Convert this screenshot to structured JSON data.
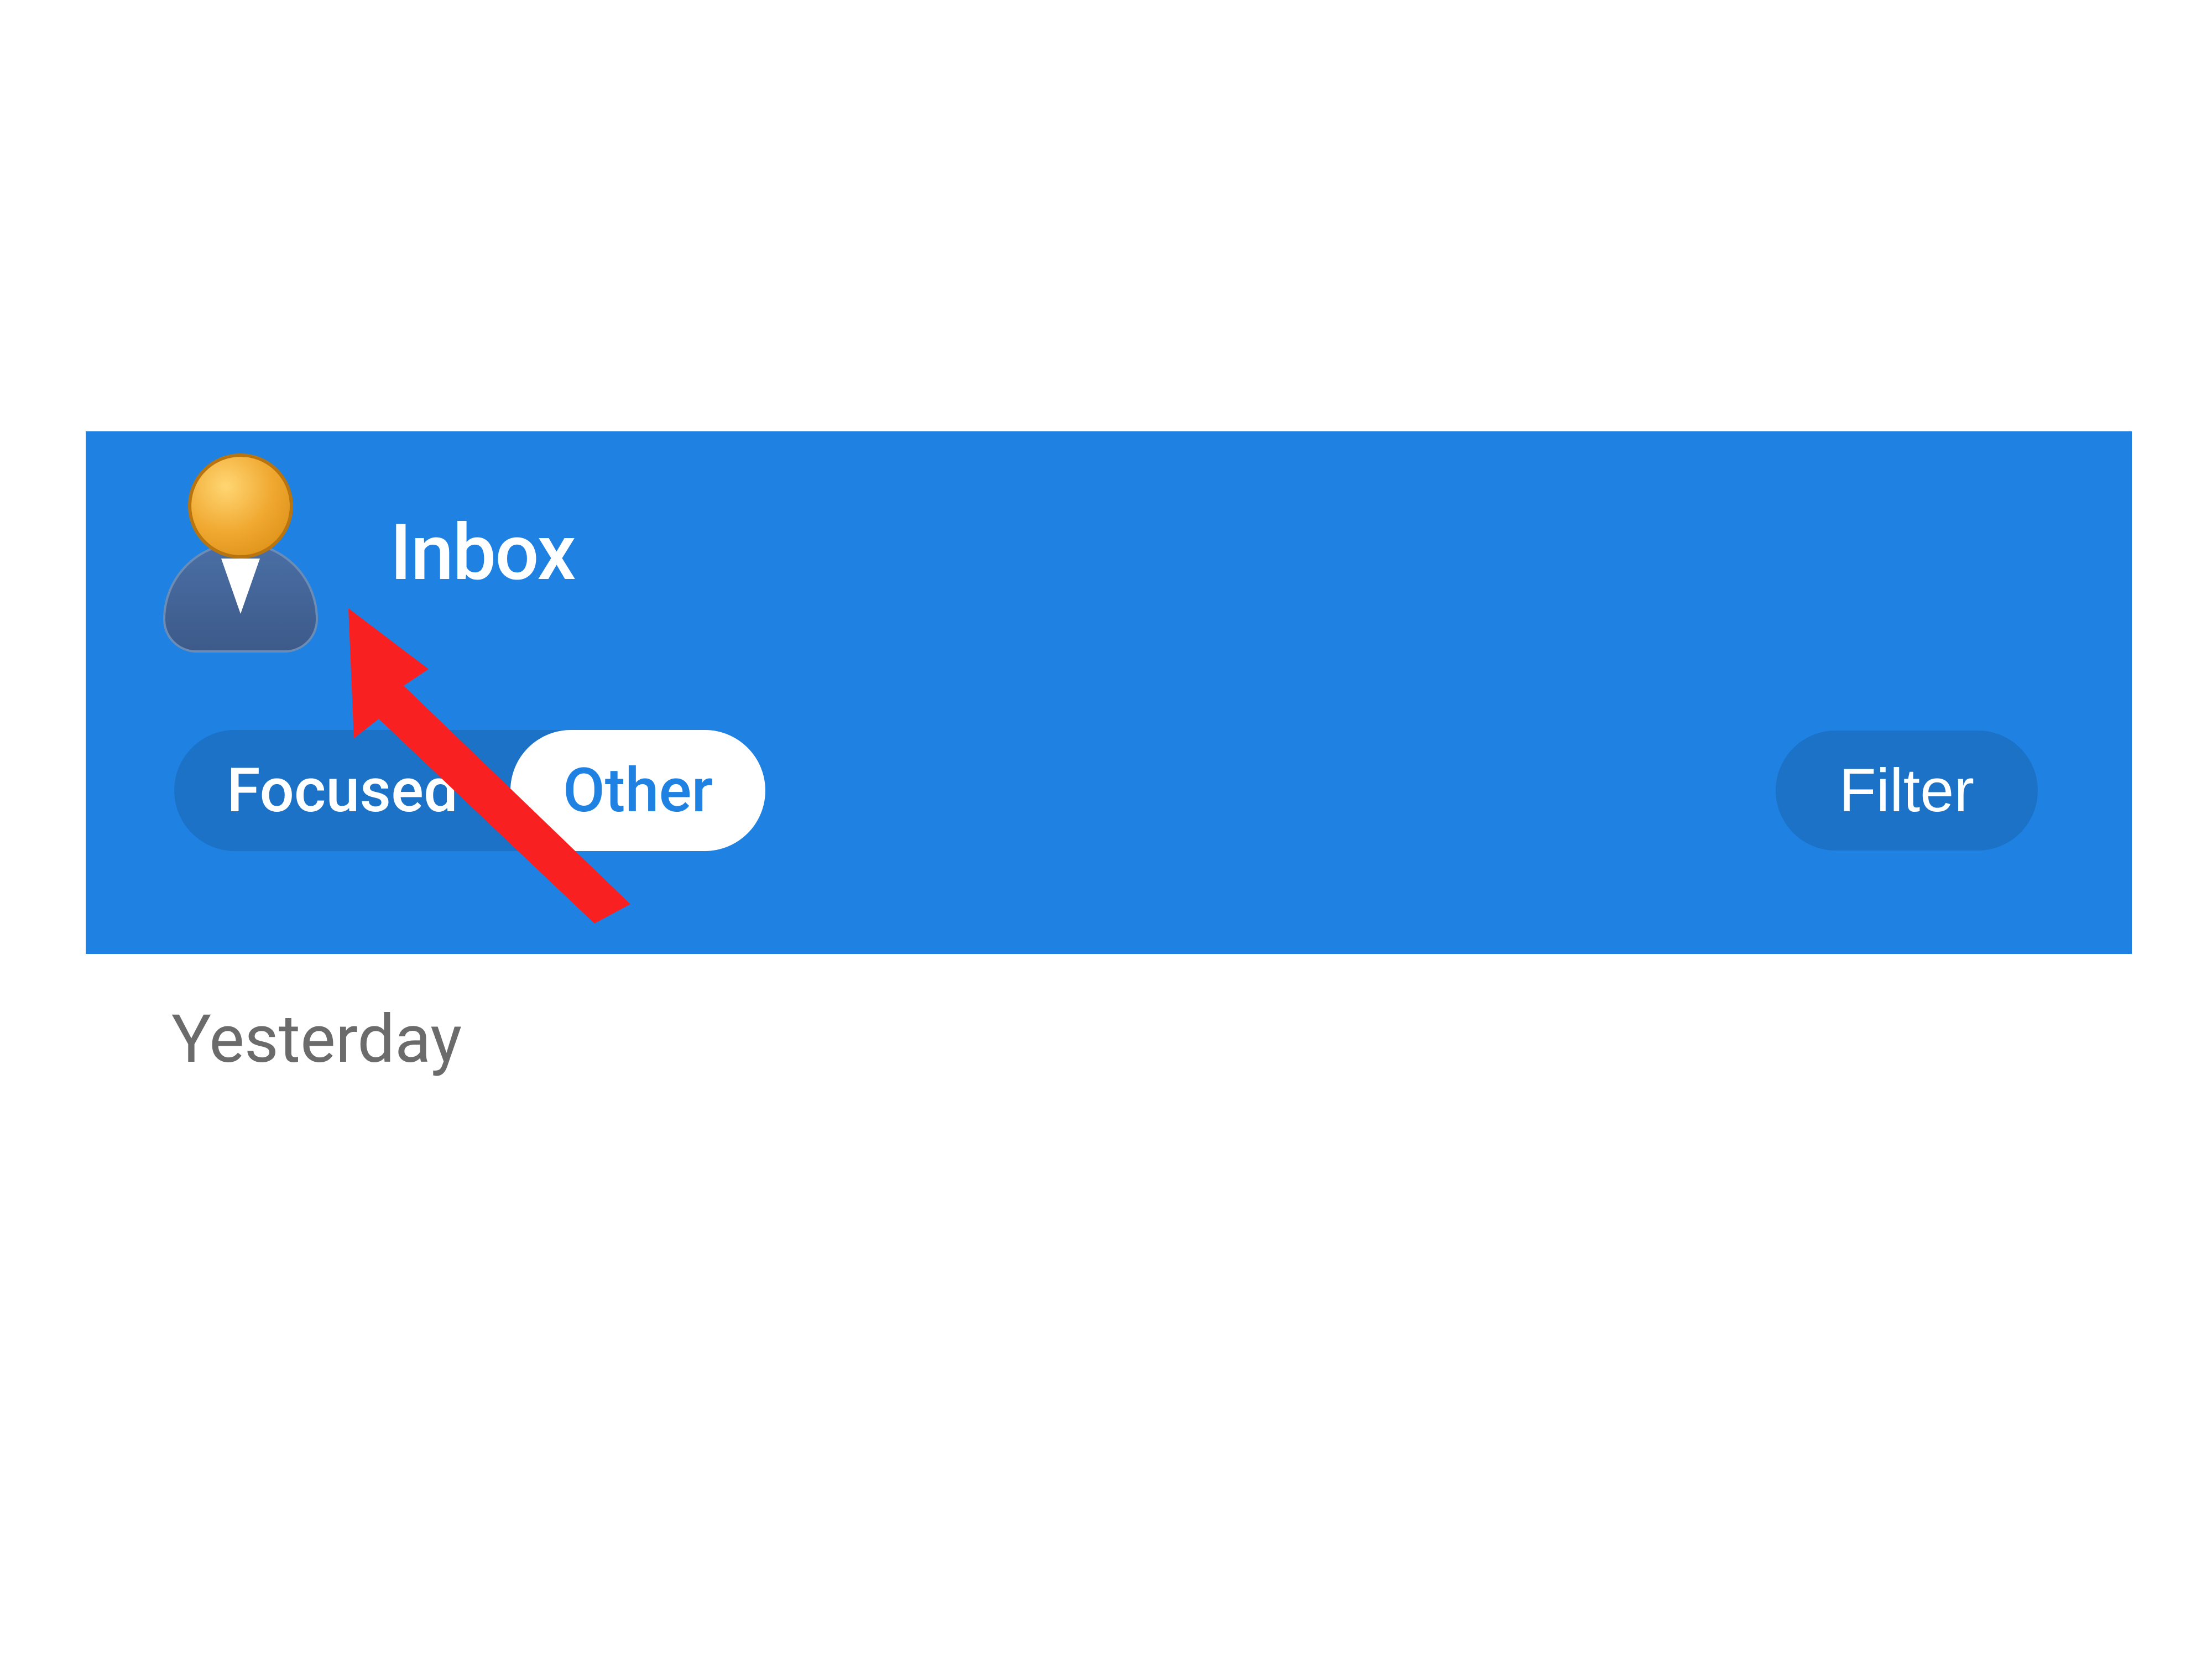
{
  "header": {
    "title": "Inbox",
    "tabs": {
      "focused_label": "Focused",
      "other_label": "Other"
    },
    "filter_label": "Filter"
  },
  "content": {
    "date_header": "Yesterday"
  },
  "icons": {
    "avatar": "user-avatar-icon"
  },
  "colors": {
    "header_bg": "#1f82e3",
    "tab_active_bg": "#ffffff",
    "tab_active_text": "#1f82e3",
    "tab_inactive_text": "#ffffff",
    "filter_text": "#ffffff",
    "date_header_text": "#6b6b6b",
    "arrow_annotation": "#f82020"
  }
}
